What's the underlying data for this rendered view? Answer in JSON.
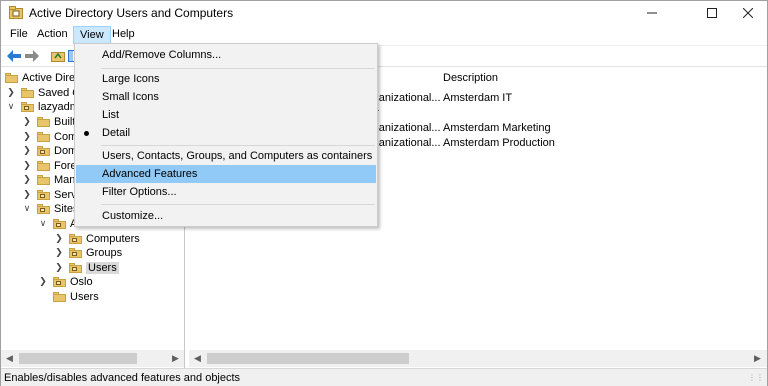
{
  "window": {
    "title": "Active Directory Users and Computers"
  },
  "menubar": {
    "file": "File",
    "action": "Action",
    "view": "View",
    "help": "Help"
  },
  "view_menu": {
    "add_remove_columns": "Add/Remove Columns...",
    "large_icons": "Large Icons",
    "small_icons": "Small Icons",
    "list": "List",
    "detail": "Detail",
    "containers": "Users, Contacts, Groups, and Computers as containers",
    "advanced_features": "Advanced Features",
    "filter_options": "Filter Options...",
    "customize": "Customize..."
  },
  "tree": {
    "root": "Active Directory",
    "saved_queries": "Saved Q",
    "domain": "lazyadm",
    "builtin": "Built",
    "computers": "Com",
    "domain_controllers": "Dom",
    "foreign": "Fore",
    "managed": "Man",
    "service": "Serv",
    "sites": "Sites",
    "amsterdam": "A",
    "amsterdam_computers": "Computers",
    "amsterdam_groups": "Groups",
    "amsterdam_users": "Users",
    "oslo": "Oslo",
    "users": "Users"
  },
  "list": {
    "columns": {
      "type": "e",
      "description": "Description"
    },
    "rows": [
      {
        "type": "rganizational...",
        "description": "Amsterdam IT"
      },
      {
        "type": "er",
        "description": ""
      },
      {
        "type": "rganizational...",
        "description": "Amsterdam Marketing"
      },
      {
        "type": "rganizational...",
        "description": "Amsterdam Production"
      }
    ]
  },
  "status": {
    "text": "Enables/disables advanced features and objects"
  },
  "colors": {
    "menu_highlight": "#91c9f7",
    "active_menu": "#cce8ff",
    "folder": "#e8c46a"
  }
}
